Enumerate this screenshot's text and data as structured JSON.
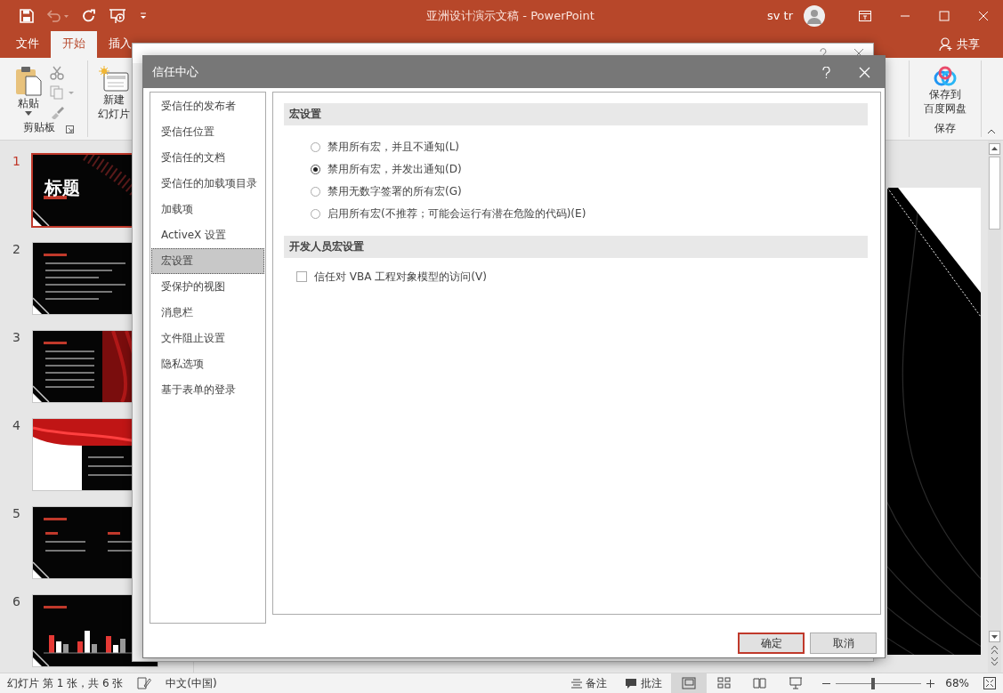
{
  "window": {
    "title": "亚洲设计演示文稿  -  PowerPoint",
    "user": "sv tr"
  },
  "ribbon_tabs": [
    {
      "label": "文件",
      "selected": false
    },
    {
      "label": "开始",
      "selected": true
    },
    {
      "label": "插入",
      "selected": false
    }
  ],
  "share": "共享",
  "clipboard_group": {
    "label": "剪贴板",
    "paste": "粘贴"
  },
  "slides_group": {
    "new_slide": [
      "新建",
      "幻灯片"
    ]
  },
  "save_group": {
    "label": "保存",
    "button": [
      "保存到",
      "百度网盘"
    ]
  },
  "slides": [
    {
      "number": "1",
      "selected": true,
      "kind": "title",
      "title": "标题"
    },
    {
      "number": "2",
      "selected": false,
      "kind": "bullets"
    },
    {
      "number": "3",
      "selected": false,
      "kind": "split"
    },
    {
      "number": "4",
      "selected": false,
      "kind": "banner"
    },
    {
      "number": "5",
      "selected": false,
      "kind": "columns"
    },
    {
      "number": "6",
      "selected": false,
      "kind": "chart"
    }
  ],
  "status_bar": {
    "slide_info": "幻灯片 第 1 张，共 6 张",
    "language": "中文(中国)",
    "notes": "备注",
    "comments": "批注",
    "views": [
      {
        "kind": "normal",
        "selected": true
      },
      {
        "kind": "sorter",
        "selected": false
      },
      {
        "kind": "reading",
        "selected": false
      },
      {
        "kind": "show",
        "selected": false
      }
    ],
    "zoom": {
      "reading": "68%",
      "level": 0.43
    }
  },
  "trust_center": {
    "title": "信任中心",
    "nav": [
      {
        "label": "受信任的发布者",
        "selected": false
      },
      {
        "label": "受信任位置",
        "selected": false
      },
      {
        "label": "受信任的文档",
        "selected": false
      },
      {
        "label": "受信任的加载项目录",
        "selected": false
      },
      {
        "label": "加载项",
        "selected": false
      },
      {
        "label": "ActiveX 设置",
        "selected": false
      },
      {
        "label": "宏设置",
        "selected": true
      },
      {
        "label": "受保护的视图",
        "selected": false
      },
      {
        "label": "消息栏",
        "selected": false
      },
      {
        "label": "文件阻止设置",
        "selected": false
      },
      {
        "label": "隐私选项",
        "selected": false
      },
      {
        "label": "基于表单的登录",
        "selected": false
      }
    ],
    "sections": [
      {
        "heading": "宏设置",
        "options": [
          {
            "kind": "radio",
            "label": "禁用所有宏，并且不通知(L)",
            "selected": false
          },
          {
            "kind": "radio",
            "label": "禁用所有宏，并发出通知(D)",
            "selected": true
          },
          {
            "kind": "radio",
            "label": "禁用无数字签署的所有宏(G)",
            "selected": false
          },
          {
            "kind": "radio",
            "label": "启用所有宏(不推荐；可能会运行有潜在危险的代码)(E)",
            "selected": false
          }
        ]
      },
      {
        "heading": "开发人员宏设置",
        "options": [
          {
            "kind": "checkbox",
            "label": "信任对 VBA 工程对象模型的访问(V)",
            "checked": false
          }
        ]
      }
    ],
    "buttons": [
      {
        "label": "确定",
        "default": true
      },
      {
        "label": "取消",
        "default": false
      }
    ]
  }
}
